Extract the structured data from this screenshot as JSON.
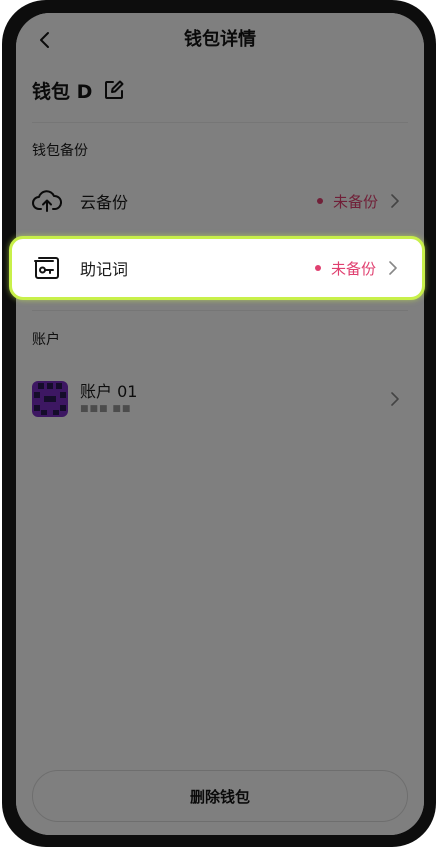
{
  "header": {
    "title": "钱包详情"
  },
  "wallet": {
    "name": "钱包 D"
  },
  "backup_section": {
    "label": "钱包备份",
    "items": [
      {
        "label": "云备份",
        "status": "未备份"
      },
      {
        "label": "助记词",
        "status": "未备份"
      }
    ]
  },
  "account_section": {
    "label": "账户",
    "accounts": [
      {
        "name": "账户 01",
        "address": "■■■ ■■"
      }
    ]
  },
  "footer": {
    "delete_label": "删除钱包"
  },
  "colors": {
    "status_red": "#e04070",
    "highlight_border": "#c8f04a",
    "avatar_purple": "#7b2fc4"
  }
}
